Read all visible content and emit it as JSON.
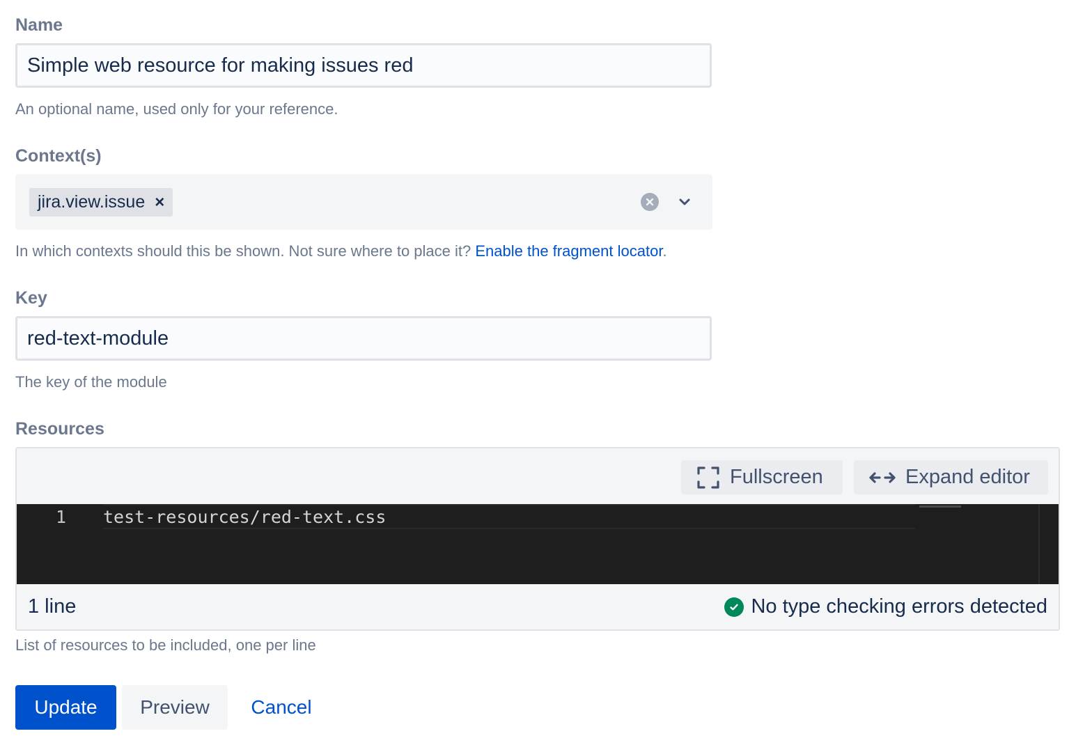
{
  "name_field": {
    "label": "Name",
    "value": "Simple web resource for making issues red",
    "help": "An optional name, used only for your reference."
  },
  "contexts_field": {
    "label": "Context(s)",
    "selected": [
      "jira.view.issue"
    ],
    "chip_remove_glyph": "×",
    "help_prefix": "In which contexts should this be shown. Not sure where to place it?",
    "help_link": "Enable the fragment locator",
    "help_suffix": "."
  },
  "key_field": {
    "label": "Key",
    "value": "red-text-module",
    "help": "The key of the module"
  },
  "resources_field": {
    "label": "Resources",
    "toolbar": {
      "fullscreen_label": "Fullscreen",
      "expand_label": "Expand editor"
    },
    "editor": {
      "lines": [
        {
          "number": "1",
          "text": "test-resources/red-text.css"
        }
      ]
    },
    "footer": {
      "line_count": "1 line",
      "status_text": "No type checking errors detected",
      "status_color": "#00875a"
    },
    "help": "List of resources to be included, one per line"
  },
  "actions": {
    "update_label": "Update",
    "preview_label": "Preview",
    "cancel_label": "Cancel"
  },
  "colors": {
    "primary": "#0052cc",
    "link": "#0052cc",
    "editor_bg": "#1e1e1e",
    "success": "#00875a"
  }
}
